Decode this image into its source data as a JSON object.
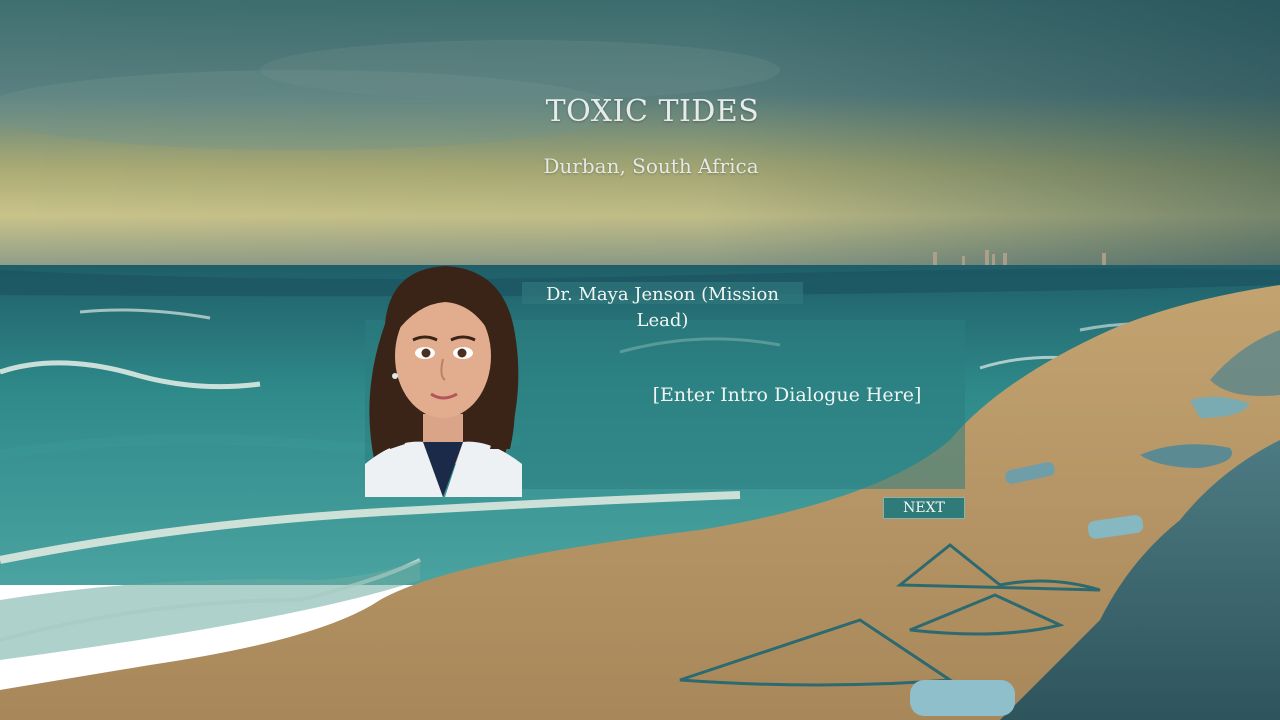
{
  "game": {
    "title": "TOXIC TIDES",
    "location": "Durban, South Africa"
  },
  "dialog": {
    "speaker": "Dr. Maya Jenson (Mission Lead)",
    "text": "[Enter Intro Dialogue Here]",
    "next_label": "NEXT"
  },
  "colors": {
    "panel": "#2c7e80",
    "button": "#2f7b7a",
    "text": "#f0f5f3"
  }
}
